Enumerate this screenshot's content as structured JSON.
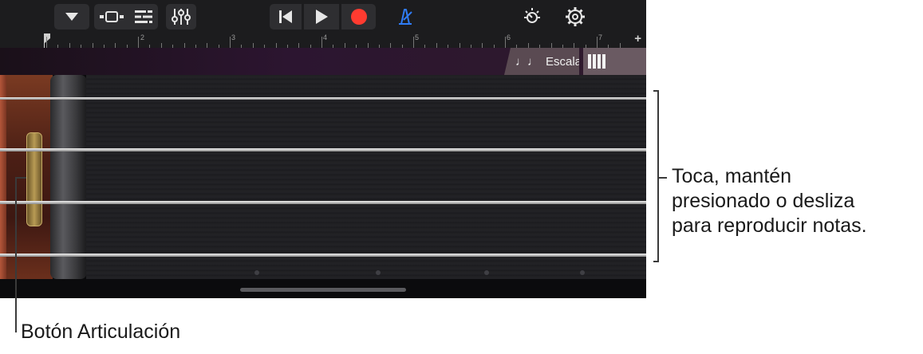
{
  "toolbar": {
    "buttons": [
      {
        "name": "tracks-dropdown-button",
        "icon": "triangle-down-icon"
      },
      {
        "name": "view-toggle-button",
        "icon": "browser-view-icon"
      },
      {
        "name": "tracks-view-button",
        "icon": "tracks-icon"
      },
      {
        "name": "mixer-controls-button",
        "icon": "sliders-icon"
      },
      {
        "name": "go-to-start-button",
        "icon": "skip-back-icon"
      },
      {
        "name": "play-button",
        "icon": "play-icon"
      },
      {
        "name": "record-button",
        "icon": "record-icon"
      },
      {
        "name": "metronome-button",
        "icon": "metronome-icon"
      },
      {
        "name": "master-effects-button",
        "icon": "brightness-dial-icon"
      },
      {
        "name": "settings-button",
        "icon": "gear-icon"
      }
    ],
    "record_color": "#ff3b30",
    "metronome_color": "#2f7cf6"
  },
  "ruler": {
    "bars": [
      "2",
      "3",
      "4",
      "5",
      "6",
      "7"
    ],
    "plus_label": "+"
  },
  "scale_tab": {
    "icon": "music-note-icon",
    "label": "Escala"
  },
  "keys_tab": {
    "icon": "keyboard-icon"
  },
  "callouts": {
    "strings": [
      "Toca, mantén",
      "presionado o desliza",
      "para reproducir notas."
    ],
    "articulation": "Botón Articulación"
  }
}
